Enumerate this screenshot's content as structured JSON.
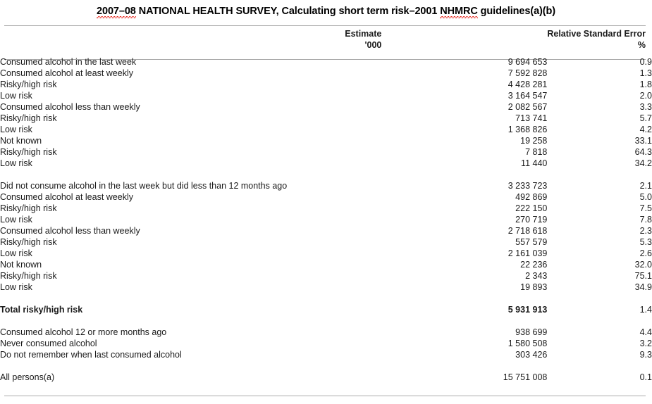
{
  "title": {
    "segment_1": "2007–08",
    "segment_2": " NATIONAL HEALTH SURVEY, Calculating short term risk–2001 ",
    "segment_3": "NHMRC",
    "segment_4": " guidelines(a)(b)"
  },
  "columns": {
    "label_header": "",
    "estimate_header_line1": "Estimate",
    "estimate_header_line2": "'000",
    "rse_header_line1": "Relative Standard Error",
    "rse_header_line2": "%"
  },
  "rows": [
    {
      "label": "Consumed alcohol in the last week",
      "indent": 0,
      "estimate": "9 694 653",
      "rse": "0.9",
      "bold": false
    },
    {
      "label": "Consumed alcohol at least weekly",
      "indent": 1,
      "estimate": "7 592 828",
      "rse": "1.3",
      "bold": false
    },
    {
      "label": "Risky/high risk",
      "indent": 2,
      "estimate": "4 428 281",
      "rse": "1.8",
      "bold": false
    },
    {
      "label": "Low risk",
      "indent": 2,
      "estimate": "3 164 547",
      "rse": "2.0",
      "bold": false
    },
    {
      "label": "Consumed alcohol less than weekly",
      "indent": 1,
      "estimate": "2 082 567",
      "rse": "3.3",
      "bold": false
    },
    {
      "label": "Risky/high risk",
      "indent": 2,
      "estimate": "713 741",
      "rse": "5.7",
      "bold": false
    },
    {
      "label": "Low risk",
      "indent": 2,
      "estimate": "1 368 826",
      "rse": "4.2",
      "bold": false
    },
    {
      "label": "Not known",
      "indent": 1,
      "estimate": "19 258",
      "rse": "33.1",
      "bold": false
    },
    {
      "label": "Risky/high risk",
      "indent": 2,
      "estimate": "7 818",
      "rse": "64.3",
      "bold": false
    },
    {
      "label": "Low risk",
      "indent": 2,
      "estimate": "11 440",
      "rse": "34.2",
      "bold": false
    },
    {
      "spacer": true
    },
    {
      "label": "Did not consume alcohol in the last week but did less than 12 months ago",
      "indent": 0,
      "estimate": "3 233 723",
      "rse": "2.1",
      "bold": false
    },
    {
      "label": "Consumed alcohol at least weekly",
      "indent": 1,
      "estimate": "492 869",
      "rse": "5.0",
      "bold": false
    },
    {
      "label": "Risky/high risk",
      "indent": 2,
      "estimate": "222 150",
      "rse": "7.5",
      "bold": false
    },
    {
      "label": "Low risk",
      "indent": 2,
      "estimate": "270 719",
      "rse": "7.8",
      "bold": false
    },
    {
      "label": "Consumed alcohol less than weekly",
      "indent": 1,
      "estimate": "2 718 618",
      "rse": "2.3",
      "bold": false
    },
    {
      "label": "Risky/high risk",
      "indent": 2,
      "estimate": "557 579",
      "rse": "5.3",
      "bold": false
    },
    {
      "label": "Low risk",
      "indent": 2,
      "estimate": "2 161 039",
      "rse": "2.6",
      "bold": false
    },
    {
      "label": "Not known",
      "indent": 1,
      "estimate": "22 236",
      "rse": "32.0",
      "bold": false
    },
    {
      "label": "Risky/high risk",
      "indent": 2,
      "estimate": "2 343",
      "rse": "75.1",
      "bold": false
    },
    {
      "label": "Low risk",
      "indent": 2,
      "estimate": "19 893",
      "rse": "34.9",
      "bold": false
    },
    {
      "spacer": true
    },
    {
      "label": "Total risky/high risk",
      "indent": 1,
      "estimate": "5 931 913",
      "rse": "1.4",
      "bold": true
    },
    {
      "spacer": true
    },
    {
      "label": "Consumed alcohol 12 or more months ago",
      "indent": 0,
      "estimate": "938 699",
      "rse": "4.4",
      "bold": false
    },
    {
      "label": "Never consumed alcohol",
      "indent": 0,
      "estimate": "1 580 508",
      "rse": "3.2",
      "bold": false
    },
    {
      "label": "Do not remember when last consumed alcohol",
      "indent": 0,
      "estimate": "303 426",
      "rse": "9.3",
      "bold": false
    },
    {
      "spacer": true
    },
    {
      "label": "All persons(a)",
      "indent": 0,
      "estimate": "15 751 008",
      "rse": "0.1",
      "bold": false
    }
  ]
}
